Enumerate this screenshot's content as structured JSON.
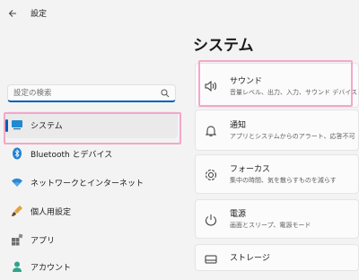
{
  "window": {
    "title": "設定"
  },
  "search": {
    "placeholder": "設定の検索"
  },
  "sidebar": {
    "items": [
      {
        "label": "システム",
        "icon": "monitor-icon",
        "selected": true
      },
      {
        "label": "Bluetooth とデバイス",
        "icon": "bluetooth-icon"
      },
      {
        "label": "ネットワークとインターネット",
        "icon": "wifi-icon"
      },
      {
        "label": "個人用設定",
        "icon": "brush-icon"
      },
      {
        "label": "アプリ",
        "icon": "apps-icon"
      },
      {
        "label": "アカウント",
        "icon": "person-icon"
      }
    ]
  },
  "main": {
    "title": "システム",
    "cards": [
      {
        "title": "サウンド",
        "subtitle": "音量レベル、出力、入力、サウンド デバイス",
        "icon": "speaker-icon"
      },
      {
        "title": "通知",
        "subtitle": "アプリとシステムからのアラート、応答不可",
        "icon": "bell-icon"
      },
      {
        "title": "フォーカス",
        "subtitle": "集中の時間、気を散らすものを減らす",
        "icon": "focus-icon"
      },
      {
        "title": "電源",
        "subtitle": "画面とスリープ、電源モード",
        "icon": "power-icon"
      },
      {
        "title": "ストレージ",
        "subtitle": "",
        "icon": "storage-icon"
      }
    ]
  },
  "colors": {
    "accent": "#005fb8",
    "highlight": "#f4a7c9"
  }
}
